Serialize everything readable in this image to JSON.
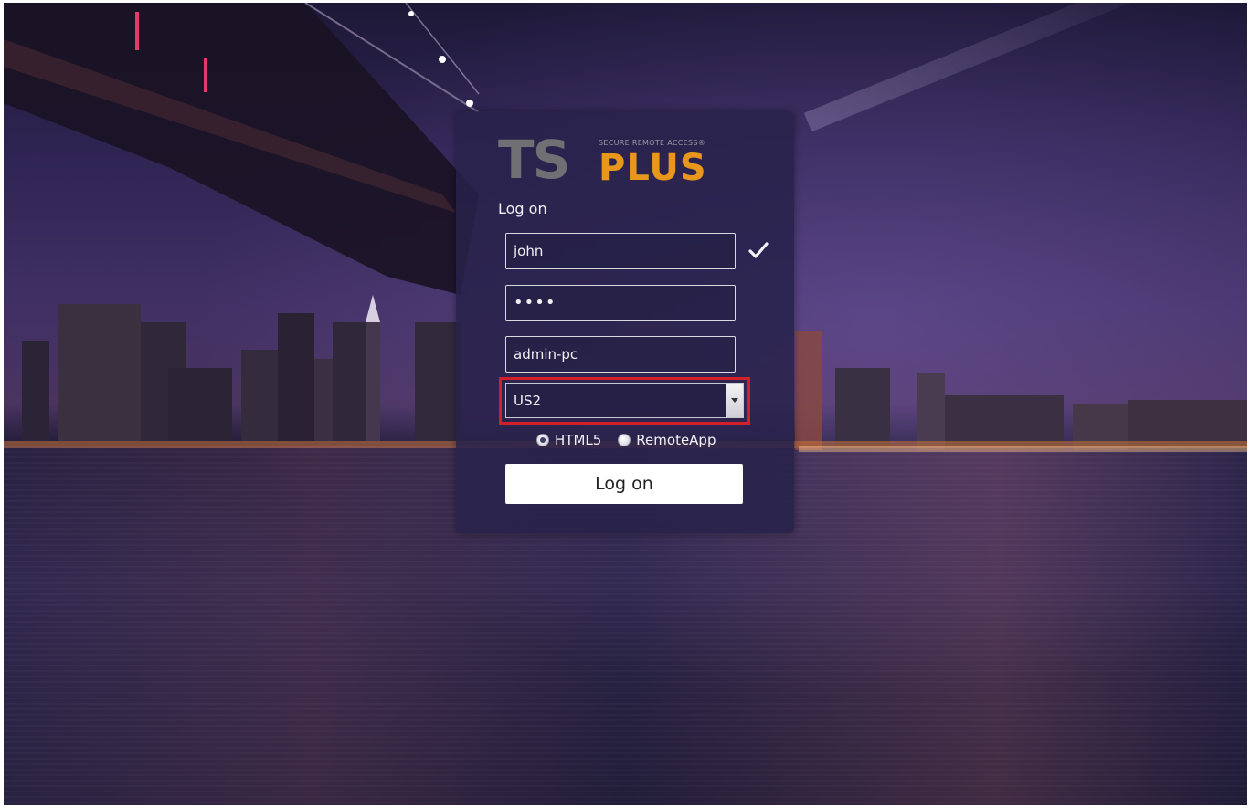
{
  "app": {
    "brand_main": "TS",
    "brand_secondary": "PLUS",
    "brand_tagline": "SECURE REMOTE ACCESS®"
  },
  "login": {
    "heading": "Log on",
    "username": "john",
    "password_mask": "••••",
    "server": "admin-pc",
    "selected_farm": "US2",
    "client_options": [
      {
        "label": "HTML5",
        "checked": true
      },
      {
        "label": "RemoteApp",
        "checked": false
      }
    ],
    "submit_label": "Log on",
    "highlight_color": "#d2202a",
    "brand_orange": "#e8961c"
  },
  "icons": {
    "validated": "check-icon",
    "select": "chevron-down-icon"
  }
}
